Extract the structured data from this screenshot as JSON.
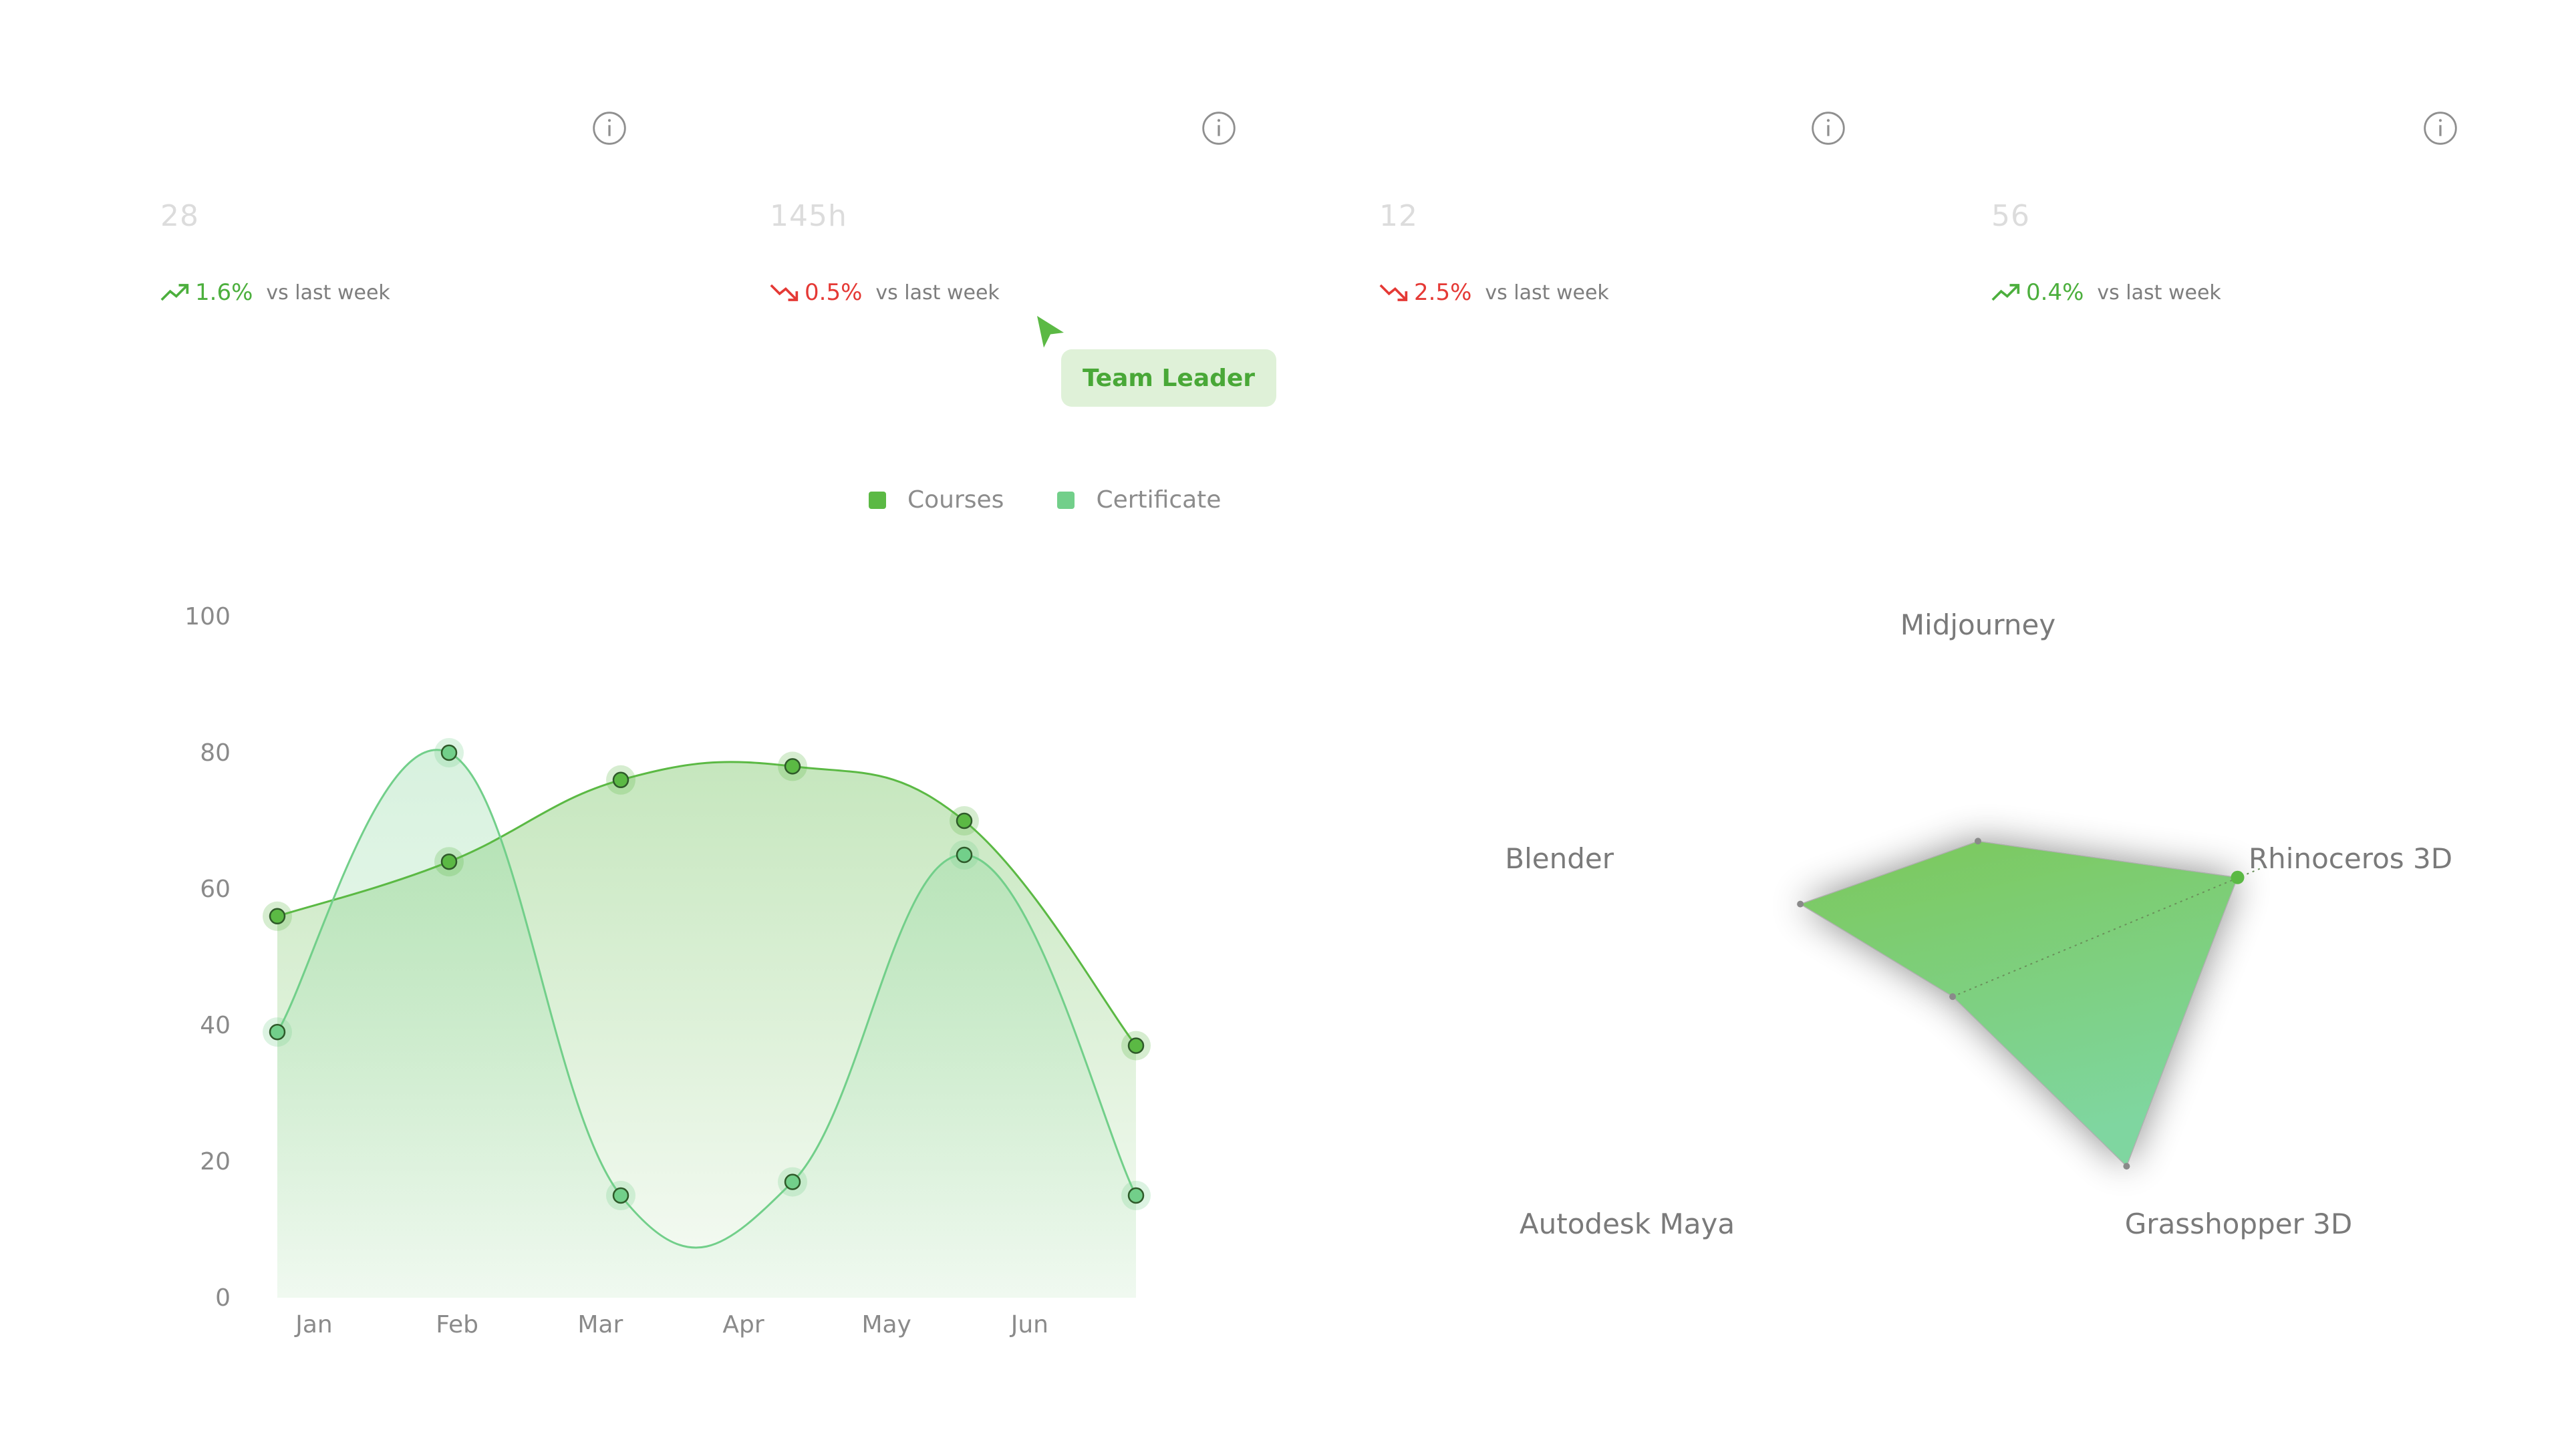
{
  "stats": [
    {
      "value": "28",
      "change": "1.6%",
      "direction": "up",
      "label": "vs last week"
    },
    {
      "value": "145h",
      "change": "0.5%",
      "direction": "down",
      "label": "vs last week"
    },
    {
      "value": "12",
      "change": "2.5%",
      "direction": "down",
      "label": "vs last week"
    },
    {
      "value": "56",
      "change": "0.4%",
      "direction": "up",
      "label": "vs last week"
    }
  ],
  "tooltip": {
    "label": "Team Leader"
  },
  "legend": [
    {
      "label": "Courses",
      "color": "#5bb944"
    },
    {
      "label": "Certificate",
      "color": "#72cf8a"
    }
  ],
  "chart_data": [
    {
      "type": "line",
      "categories": [
        "Jan",
        "Feb",
        "Mar",
        "Apr",
        "May",
        "Jun"
      ],
      "y_ticks": [
        "0",
        "20",
        "40",
        "60",
        "80",
        "100"
      ],
      "ylim": [
        0,
        100
      ],
      "series": [
        {
          "name": "Courses",
          "color": "#5bb944",
          "values": [
            56,
            64,
            76,
            78,
            70,
            37
          ]
        },
        {
          "name": "Certificate",
          "color": "#72cf8a",
          "values": [
            39,
            80,
            15,
            17,
            65,
            15
          ]
        }
      ]
    },
    {
      "type": "radar",
      "axes": [
        "Midjourney",
        "Rhinoceros 3D",
        "Grasshopper 3D",
        "Autodesk Maya",
        "Blender"
      ],
      "values": [
        0.42,
        0.95,
        0.88,
        0.15,
        0.65
      ],
      "max": 1,
      "color": "#7fcc6a"
    }
  ]
}
